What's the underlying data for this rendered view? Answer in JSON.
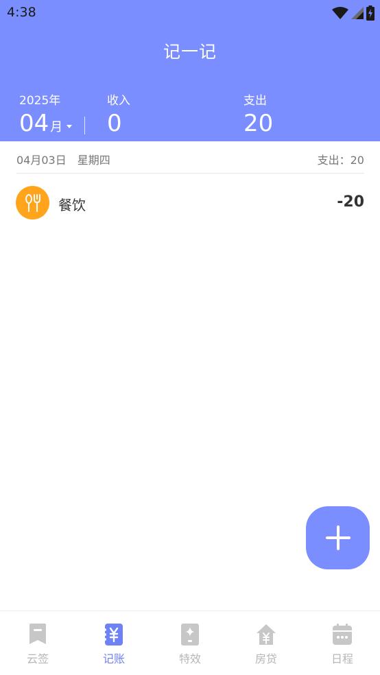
{
  "status_bar": {
    "time": "4:38"
  },
  "header": {
    "title": "记一记",
    "year_label": "2025年",
    "month_value": "04",
    "month_suffix": "月",
    "income_label": "收入",
    "income_value": "0",
    "expense_label": "支出",
    "expense_value": "20"
  },
  "day_group": {
    "date": "04月03日　星期四",
    "total": "支出：20"
  },
  "entries": [
    {
      "category": "餐饮",
      "amount": "-20",
      "icon": "fork-spoon-icon"
    }
  ],
  "fab": {
    "icon": "plus-icon"
  },
  "bottom_nav": {
    "items": [
      {
        "label": "云签",
        "icon": "bookmark-icon",
        "active": false
      },
      {
        "label": "记账",
        "icon": "yuan-ledger-icon",
        "active": true
      },
      {
        "label": "特效",
        "icon": "sparkle-icon",
        "active": false
      },
      {
        "label": "房贷",
        "icon": "house-yuan-icon",
        "active": false
      },
      {
        "label": "日程",
        "icon": "calendar-icon",
        "active": false
      }
    ]
  },
  "colors": {
    "primary": "#7B8EFF",
    "nav_active": "#6F82F5",
    "nav_inactive": "#b6b6b6",
    "category_food": "#FFA41B"
  }
}
